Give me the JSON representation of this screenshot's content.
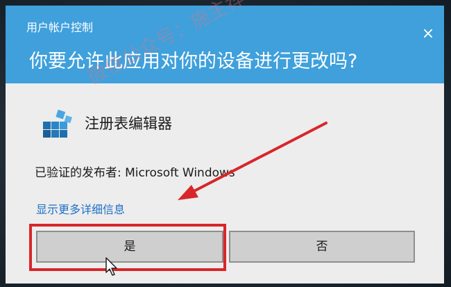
{
  "dialog": {
    "uac_title": "用户帐户控制",
    "question": "你要允许此应用对你的设备进行更改吗?",
    "close_symbol": "×",
    "app_name": "注册表编辑器",
    "publisher": "已验证的发布者: Microsoft Windows",
    "details_link": "显示更多详细信息",
    "yes_label": "是",
    "no_label": "否"
  },
  "watermark": {
    "text": "微信公众号：施主荐"
  },
  "icons": {
    "app": "registry-editor-icon",
    "close": "close-icon",
    "cursor": "mouse-cursor-icon"
  },
  "colors": {
    "header": "#3fa0dc",
    "link": "#1f6fc6",
    "annotation": "#d8262a"
  }
}
